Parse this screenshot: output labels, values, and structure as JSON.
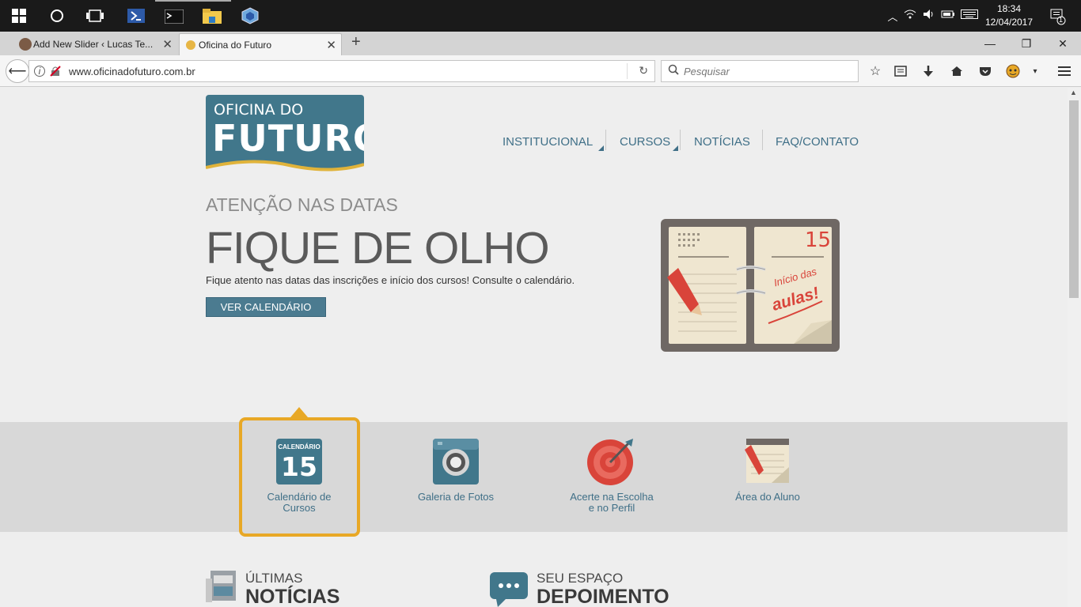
{
  "taskbar": {
    "icons": [
      "windows-start-icon",
      "cortana-circle-icon",
      "task-view-icon",
      "powershell-icon",
      "terminal-icon",
      "file-explorer-icon",
      "virtualbox-icon"
    ],
    "tray_icons": [
      "chevron-up-icon",
      "wifi-icon",
      "volume-icon",
      "battery-icon",
      "keyboard-icon"
    ],
    "time": "18:34",
    "date": "12/04/2017",
    "notifications_count": "1"
  },
  "browser": {
    "tabs": [
      {
        "title": "Add New Slider ‹ Lucas Te...",
        "active": false
      },
      {
        "title": "Oficina do Futuro",
        "active": true
      }
    ],
    "new_tab": "+",
    "window_controls": [
      "—",
      "❐",
      "✕"
    ],
    "url": "www.oficinadofuturo.com.br",
    "search_placeholder": "Pesquisar"
  },
  "site": {
    "logo": {
      "line1": "OFICINA DO",
      "line2": "FUTURO"
    },
    "menu": [
      "INSTITUCIONAL",
      "CURSOS",
      "NOTÍCIAS",
      "FAQ/CONTATO"
    ],
    "hero": {
      "kicker": "ATENÇÃO NAS DATAS",
      "headline": "FIQUE DE OLHO",
      "lead": "Fique atento nas datas das inscrições e início dos cursos! Consulte o calendário.",
      "cta": "VER CALENDÁRIO",
      "illustration": {
        "day": "15",
        "note_line1": "Início das",
        "note_line2": "aulas!"
      }
    },
    "features": [
      {
        "label_l1": "Calendário de",
        "label_l2": "Cursos",
        "icon": "calendar-icon",
        "icon_title": "CALENDÁRIO",
        "icon_day": "15",
        "selected": true
      },
      {
        "label_l1": "Galeria de Fotos",
        "label_l2": "",
        "icon": "camera-icon"
      },
      {
        "label_l1": "Acerte na Escolha",
        "label_l2": "e no Perfil",
        "icon": "target-icon"
      },
      {
        "label_l1": "Área do Aluno",
        "label_l2": "",
        "icon": "notepad-icon"
      }
    ],
    "sections": [
      {
        "small": "ÚLTIMAS",
        "big": "NOTÍCIAS",
        "icon": "newspaper-icon"
      },
      {
        "small": "SEU ESPAÇO",
        "big": "DEPOIMENTO",
        "icon": "chat-bubble-icon"
      }
    ]
  }
}
